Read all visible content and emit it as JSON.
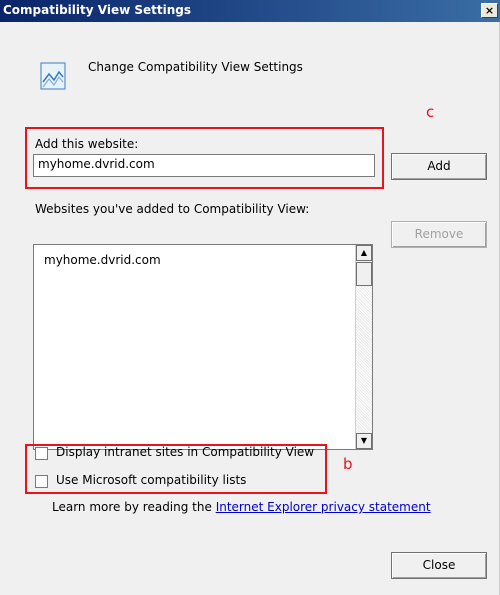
{
  "window": {
    "title": "Compatibility View Settings",
    "close_glyph": "×"
  },
  "header": {
    "icon": "compatibility-view-icon",
    "text": "Change Compatibility View Settings"
  },
  "add_section": {
    "label": "Add this website:",
    "input_value": "myhome.dvrid.com",
    "add_button": "Add"
  },
  "list_section": {
    "label": "Websites you've added to Compatibility View:",
    "items": [
      "myhome.dvrid.com"
    ],
    "remove_button": "Remove",
    "scroll_up_glyph": "▲",
    "scroll_down_glyph": "▼"
  },
  "options": {
    "intranet_label": "Display intranet sites in Compatibility View",
    "intranet_checked": false,
    "ms_lists_label": "Use Microsoft compatibility lists",
    "ms_lists_checked": false
  },
  "privacy": {
    "prefix": "Learn more by reading the ",
    "link_text": "Internet Explorer privacy statement"
  },
  "footer": {
    "close_button": "Close"
  },
  "annotations": {
    "c": "c",
    "b": "b",
    "color": "#e8141b"
  }
}
